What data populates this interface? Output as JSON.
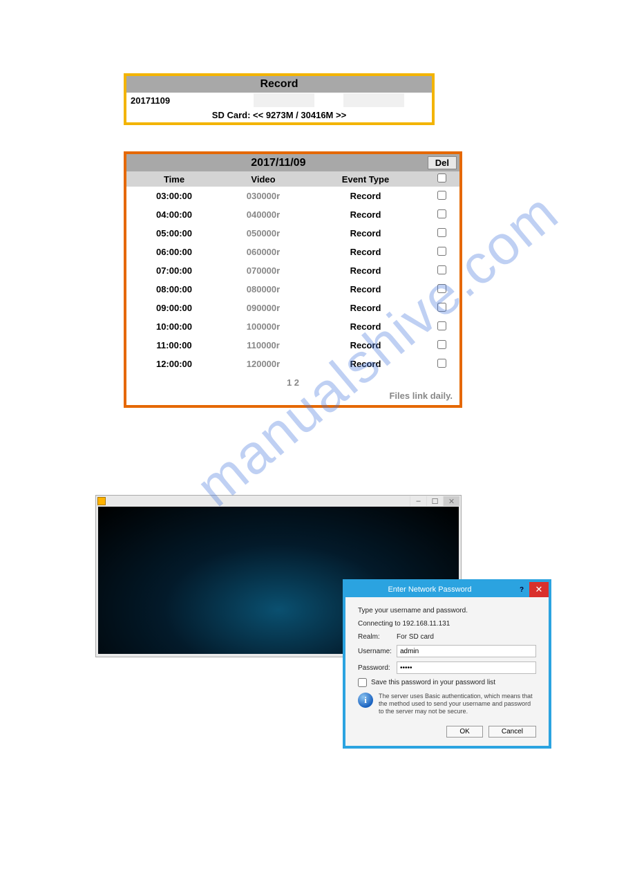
{
  "watermark": "manualshive.com",
  "record": {
    "title": "Record",
    "date": "20171109",
    "status": "SD Card: << 9273M / 30416M >>"
  },
  "table": {
    "title": "2017/11/09",
    "del_label": "Del",
    "headers": {
      "time": "Time",
      "video": "Video",
      "event": "Event Type"
    },
    "rows": [
      {
        "time": "03:00:00",
        "video": "030000r",
        "event": "Record"
      },
      {
        "time": "04:00:00",
        "video": "040000r",
        "event": "Record"
      },
      {
        "time": "05:00:00",
        "video": "050000r",
        "event": "Record"
      },
      {
        "time": "06:00:00",
        "video": "060000r",
        "event": "Record"
      },
      {
        "time": "07:00:00",
        "video": "070000r",
        "event": "Record"
      },
      {
        "time": "08:00:00",
        "video": "080000r",
        "event": "Record"
      },
      {
        "time": "09:00:00",
        "video": "090000r",
        "event": "Record"
      },
      {
        "time": "10:00:00",
        "video": "100000r",
        "event": "Record"
      },
      {
        "time": "11:00:00",
        "video": "110000r",
        "event": "Record"
      },
      {
        "time": "12:00:00",
        "video": "120000r",
        "event": "Record"
      }
    ],
    "pages": "1 2",
    "footer": "Files link daily."
  },
  "player": {
    "minimize": "–",
    "maximize": "☐",
    "close": "✕"
  },
  "dialog": {
    "title": "Enter Network Password",
    "help": "?",
    "close": "✕",
    "prompt": "Type your username and password.",
    "connecting": "Connecting to 192.168.11.131",
    "realm_label": "Realm:",
    "realm_value": "For SD card",
    "user_label": "Username:",
    "user_value": "admin",
    "pass_label": "Password:",
    "pass_value": "•••••",
    "save_label": "Save this password in your password list",
    "info_icon": "i",
    "info_text": "The server uses Basic authentication, which means that the method used to send your username and password to the server may not be secure.",
    "ok": "OK",
    "cancel": "Cancel"
  }
}
